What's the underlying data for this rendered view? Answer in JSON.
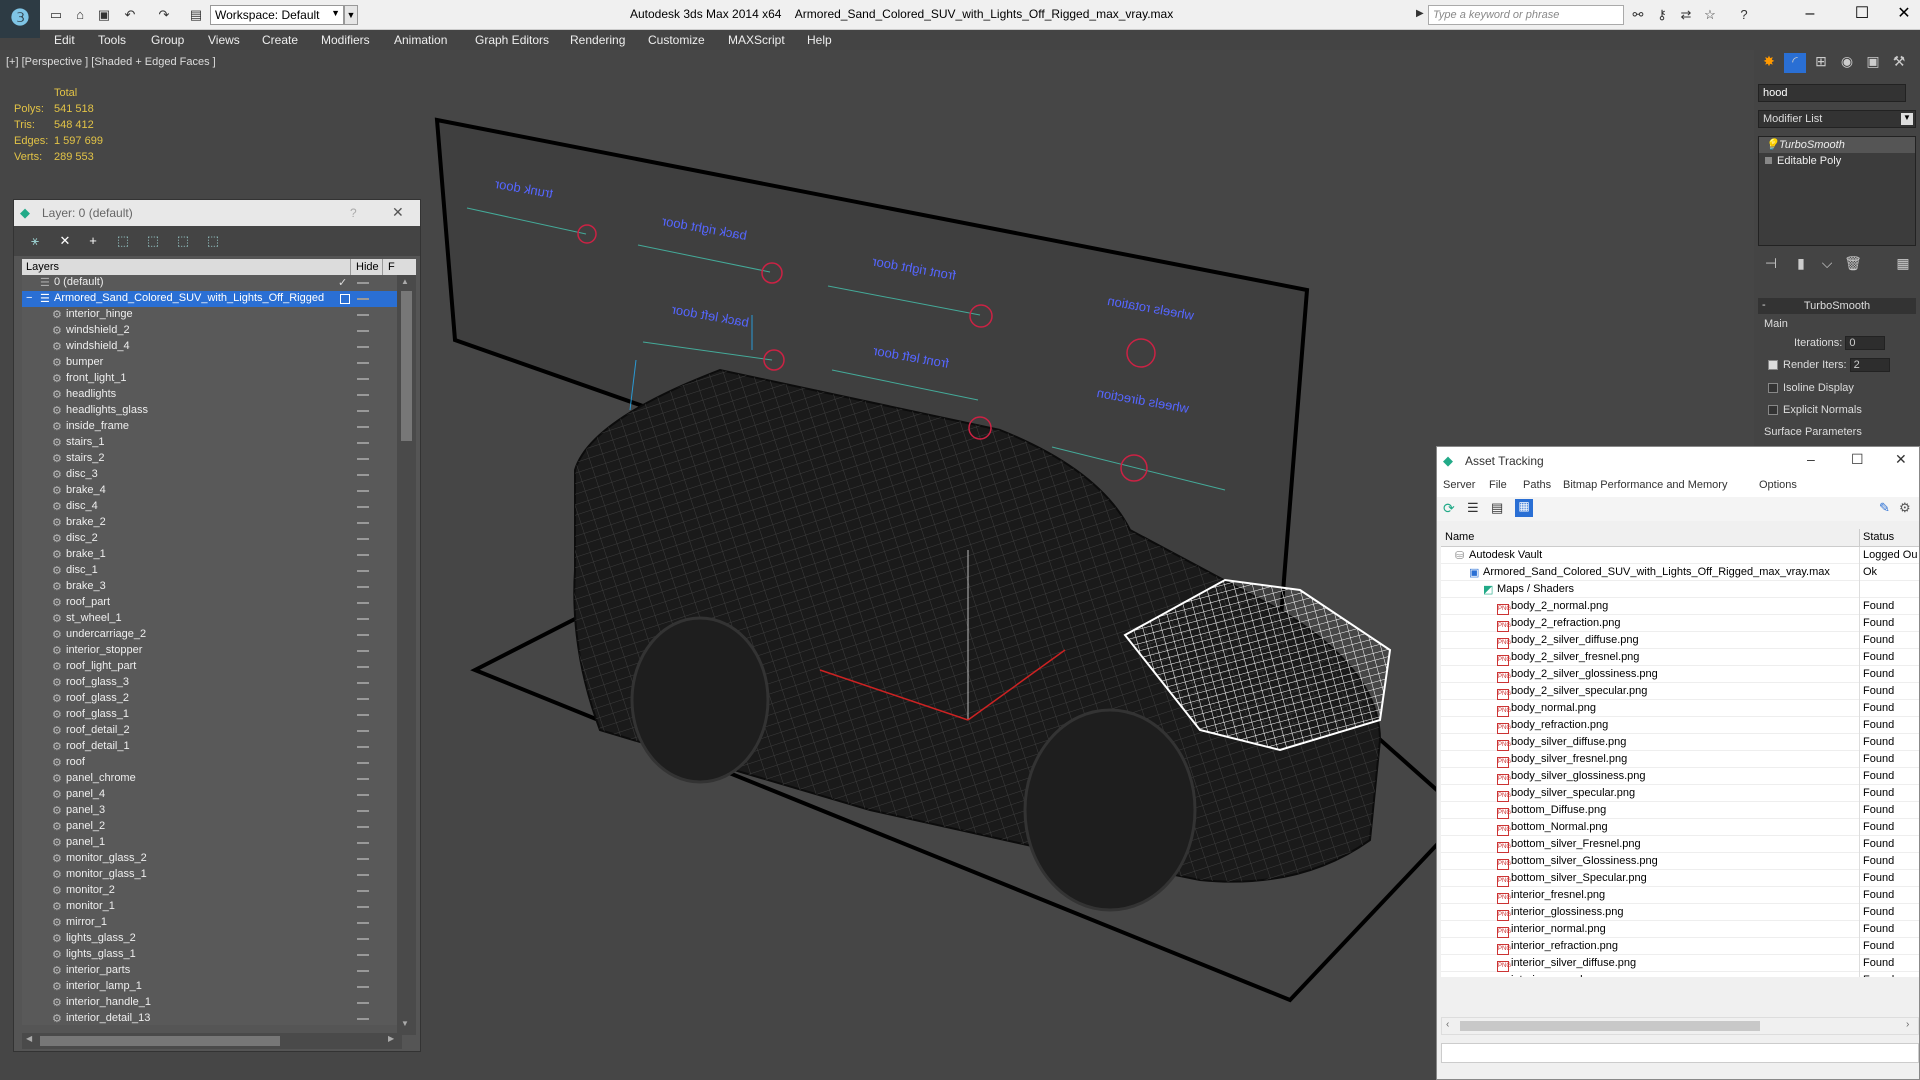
{
  "titlebar": {
    "workspace_label": "Workspace: Default",
    "app_name": "Autodesk 3ds Max  2014 x64",
    "file_name": "Armored_Sand_Colored_SUV_with_Lights_Off_Rigged_max_vray.max",
    "search_placeholder": "Type a keyword or phrase"
  },
  "menu": [
    "Edit",
    "Tools",
    "Group",
    "Views",
    "Create",
    "Modifiers",
    "Animation",
    "Graph Editors",
    "Rendering",
    "Customize",
    "MAXScript",
    "Help"
  ],
  "viewport": {
    "label": "[+] [Perspective ] [Shaded + Edged Faces ]",
    "stats_header": "Total",
    "stats": [
      {
        "label": "Polys:",
        "value": "541 518"
      },
      {
        "label": "Tris:",
        "value": "548 412"
      },
      {
        "label": "Edges:",
        "value": "1 597 699"
      },
      {
        "label": "Verts:",
        "value": "289 553"
      }
    ],
    "rig_labels": [
      "trunk door",
      "back right door",
      "front right door",
      "wheels rotation",
      "back left door",
      "front left door",
      "wheels direction"
    ]
  },
  "layer_window": {
    "title": "Layer: 0 (default)",
    "help": "?",
    "col_layers": "Layers",
    "col_hide": "Hide",
    "col_f": "F",
    "root_layers": [
      "0 (default)",
      "Armored_Sand_Colored_SUV_with_Lights_Off_Rigged"
    ],
    "objects": [
      "interior_hinge",
      "windshield_2",
      "windshield_4",
      "bumper",
      "front_light_1",
      "headlights",
      "headlights_glass",
      "inside_frame",
      "stairs_1",
      "stairs_2",
      "disc_3",
      "brake_4",
      "disc_4",
      "brake_2",
      "disc_2",
      "brake_1",
      "disc_1",
      "brake_3",
      "roof_part",
      "st_wheel_1",
      "undercarriage_2",
      "interior_stopper",
      "roof_light_part",
      "roof_glass_3",
      "roof_glass_2",
      "roof_glass_1",
      "roof_detail_2",
      "roof_detail_1",
      "roof",
      "panel_chrome",
      "panel_4",
      "panel_3",
      "panel_2",
      "panel_1",
      "monitor_glass_2",
      "monitor_glass_1",
      "monitor_2",
      "monitor_1",
      "mirror_1",
      "lights_glass_2",
      "lights_glass_1",
      "interior_parts",
      "interior_lamp_1",
      "interior_handle_1",
      "interior_detail_13"
    ]
  },
  "command_panel": {
    "object_name": "hood",
    "modifier_list": "Modifier List",
    "stack": [
      "TurboSmooth",
      "Editable Poly"
    ],
    "rollout_title": "TurboSmooth",
    "group_main": "Main",
    "iterations_label": "Iterations:",
    "iterations_value": "0",
    "render_iters_label": "Render Iters:",
    "render_iters_value": "2",
    "isoline_label": "Isoline Display",
    "explicit_normals_label": "Explicit Normals",
    "surface_params_label": "Surface Parameters"
  },
  "asset_tracking": {
    "title": "Asset Tracking",
    "menu": [
      "Server",
      "File",
      "Paths",
      "Bitmap Performance and Memory",
      "Options"
    ],
    "col_name": "Name",
    "col_status": "Status",
    "vault_name": "Autodesk Vault",
    "vault_status": "Logged Ou",
    "file_name": "Armored_Sand_Colored_SUV_with_Lights_Off_Rigged_max_vray.max",
    "file_status": "Ok",
    "maps_folder": "Maps / Shaders",
    "maps": [
      "body_2_normal.png",
      "body_2_refraction.png",
      "body_2_silver_diffuse.png",
      "body_2_silver_fresnel.png",
      "body_2_silver_glossiness.png",
      "body_2_silver_specular.png",
      "body_normal.png",
      "body_refraction.png",
      "body_silver_diffuse.png",
      "body_silver_fresnel.png",
      "body_silver_glossiness.png",
      "body_silver_specular.png",
      "bottom_Diffuse.png",
      "bottom_Normal.png",
      "bottom_silver_Fresnel.png",
      "bottom_silver_Glossiness.png",
      "bottom_silver_Specular.png",
      "interior_fresnel.png",
      "interior_glossiness.png",
      "interior_normal.png",
      "interior_refraction.png",
      "interior_silver_diffuse.png",
      "interior_specular.png"
    ],
    "map_status": "Found"
  },
  "colors": {
    "stats": "#e2c346",
    "selection": "#2a6fd4",
    "rig_text": "#5566ff",
    "rig_circle": "#cc2244"
  }
}
